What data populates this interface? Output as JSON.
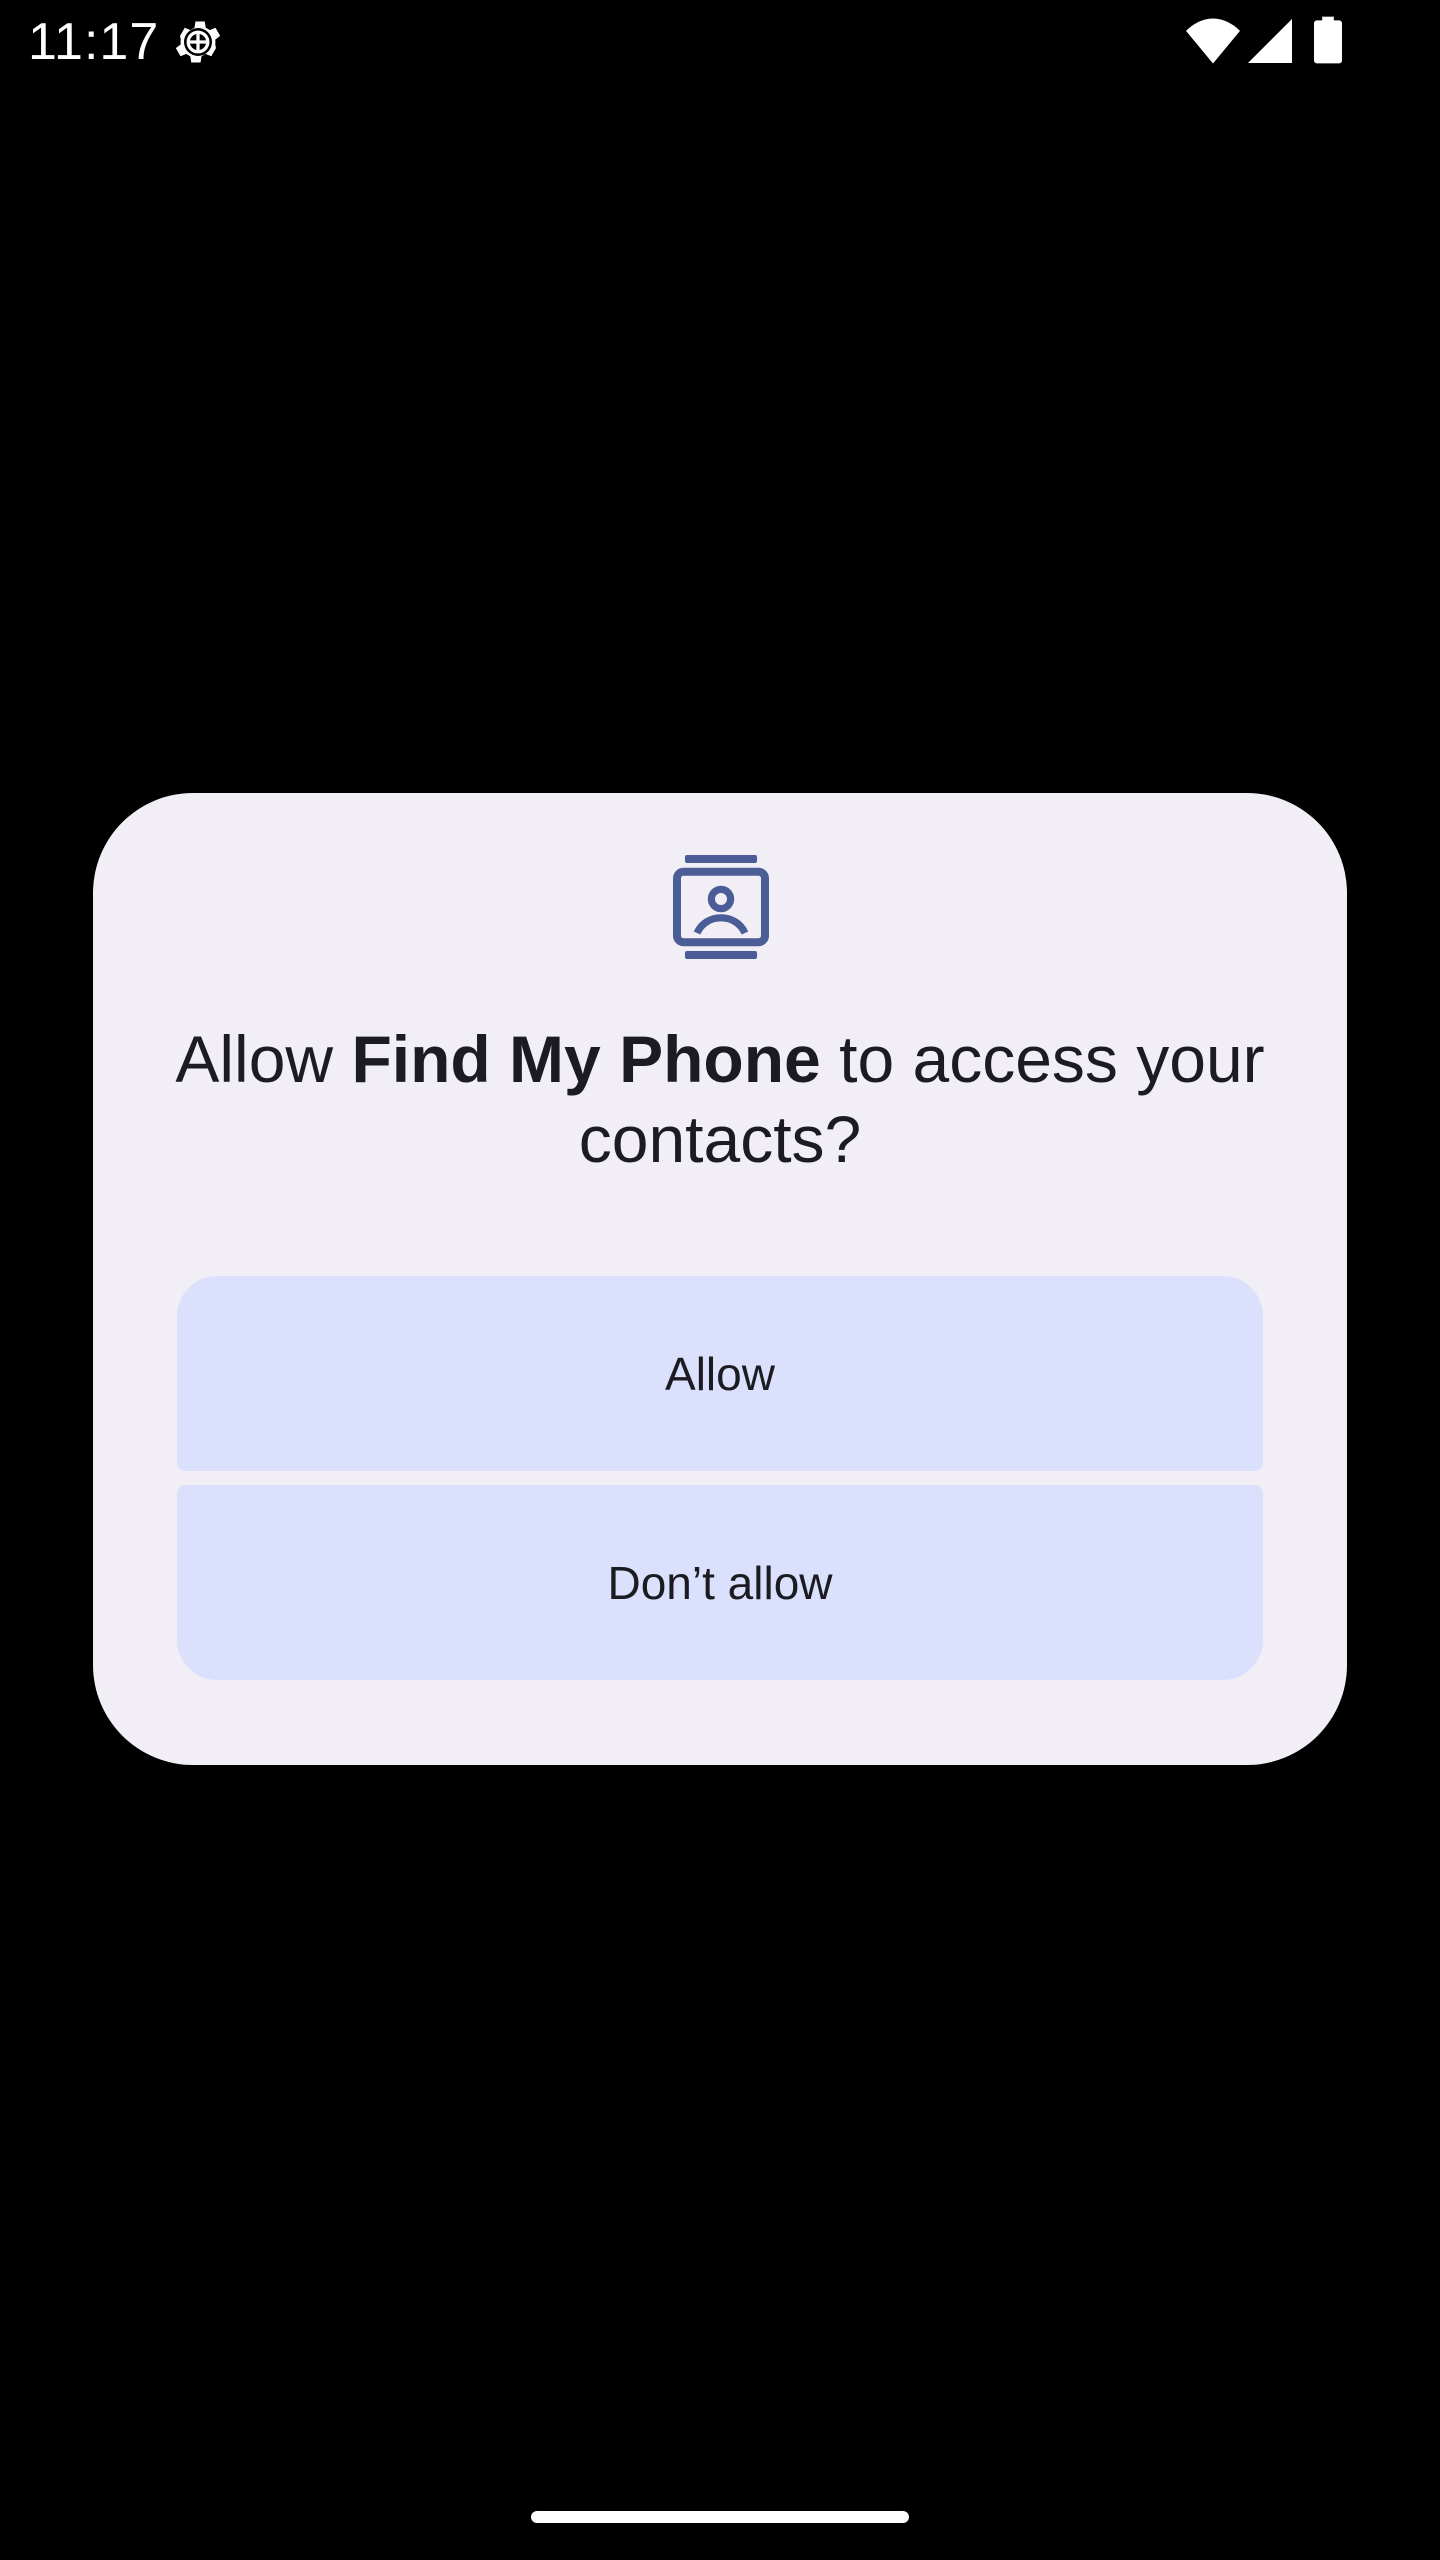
{
  "status_bar": {
    "time": "11:17",
    "icons": [
      "gear-icon",
      "wifi-icon",
      "cell-signal-icon",
      "battery-icon"
    ]
  },
  "dialog": {
    "icon": "contacts-icon",
    "title_prefix": "Allow ",
    "title_app": "Find My Phone",
    "title_suffix": " to access your contacts?",
    "allow_label": "Allow",
    "deny_label": "Don’t allow"
  },
  "colors": {
    "background": "#000000",
    "dialog_surface": "#f1eff5",
    "button_fill": "#dbe1fd",
    "icon_accent": "#4a5d96",
    "text": "#1b1b21"
  }
}
